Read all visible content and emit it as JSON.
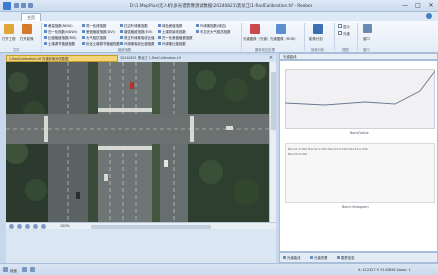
{
  "window": {
    "title": "D:\\1.MapPlus\\无人机\\多光谱影像测试数据\\20240821\\黑龙江\\1-RadCalibration.tif - Reober",
    "controls": [
      "—",
      "□",
      "✕"
    ]
  },
  "tabs": {
    "active": "主页"
  },
  "ribbon": {
    "file_buttons": [
      "打开工程",
      "打开影像"
    ],
    "col1": [
      "黄量指数(NDVI)",
      "归一化指数(NDWI)",
      "比值植被指数(RVI)",
      "土壤调节植被指数"
    ],
    "col2": [
      "同一化绿指数",
      "差值植被指数(DVI)",
      "大气阻抗指数",
      "优化土壤调节植被指数"
    ],
    "col3": [
      "红边叶绿素指数",
      "增强植被指数(EVI)",
      "修正叶绿素吸收比值",
      "叶绿素吸收比值指数"
    ],
    "col4": [
      "绿色差值指数",
      "土壤背景线指数"
    ],
    "col5": [
      "归一化差值植被指数",
      "叶绿素比值指数",
      "可见光大气阻抗指数"
    ],
    "col6": [
      "叶绿素指数(绿边)"
    ],
    "big_buttons": [
      "光谱图像（光谱）",
      "光谱图像（RGB）",
      "影像分割"
    ],
    "group_labels": [
      "文件",
      "植被指数",
      "图像常见处理",
      "影像分析",
      "视图",
      "窗口"
    ],
    "view_checks": [
      "显示",
      "光谱"
    ],
    "window_buttons": [
      "窗口"
    ]
  },
  "document": {
    "tab_active": "1-RadCalibration.tif 光谱影像测试数据",
    "tab_second": "20240821 黑龙江 1-RadCalibration.tif"
  },
  "map": {
    "zoom_text": "100%"
  },
  "right_panel": {
    "title": "光谱曲线",
    "profile_caption": "Band/Value",
    "hist_caption": "Band Histogram",
    "hist_labels": [
      "Band1:0.000 Band2:0.000 Band3:0.000 Band4:0.000",
      "Band5:0.000"
    ],
    "tabs": [
      "光谱曲线",
      "光谱查看",
      "图表信息"
    ]
  },
  "status": {
    "left": "就绪",
    "right": "X: 412327 Y: 5143856 Zoom: 1"
  },
  "colors": {
    "accent": "#3b7bd0",
    "doc_tab": "#f3d478",
    "ribbon_bg": "#e3ecf7"
  }
}
